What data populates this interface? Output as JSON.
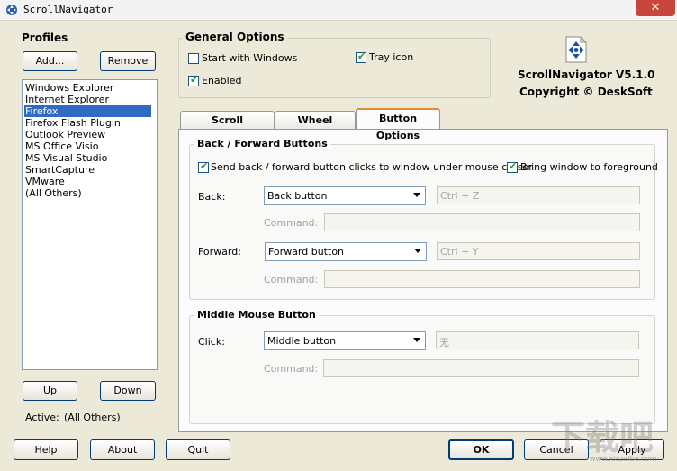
{
  "window": {
    "title": "ScrollNavigator",
    "close_label": "✕"
  },
  "profiles": {
    "heading": "Profiles",
    "add_label": "Add...",
    "remove_label": "Remove",
    "items": [
      "Windows Explorer",
      "Internet Explorer",
      "Firefox",
      "Firefox Flash Plugin",
      "Outlook Preview",
      "MS Office Visio",
      "MS Visual Studio",
      "SmartCapture",
      "VMware",
      "(All Others)"
    ],
    "selected": "Firefox",
    "up_label": "Up",
    "down_label": "Down",
    "active_label": "Active:",
    "active_value": "(All Others)"
  },
  "general": {
    "heading": "General Options",
    "start_with_windows": {
      "label": "Start with Windows",
      "checked": false
    },
    "tray_icon": {
      "label": "Tray icon",
      "checked": true
    },
    "enabled": {
      "label": "Enabled",
      "checked": true
    }
  },
  "about_box": {
    "product": "ScrollNavigator V5.1.0",
    "copyright": "Copyright © DeskSoft"
  },
  "tabs": [
    "Scroll Navigation",
    "Wheel Options",
    "Button Options"
  ],
  "active_tab": "Button Options",
  "back_forward": {
    "heading": "Back / Forward Buttons",
    "send_clicks": {
      "label": "Send back / forward button clicks to window under mouse cursor",
      "checked": true
    },
    "bring_foreground": {
      "label": "Bring window to foreground",
      "checked": true
    },
    "back_label": "Back:",
    "back_value": "Back button",
    "back_shortcut": "Ctrl + Z",
    "command_label": "Command:",
    "forward_label": "Forward:",
    "forward_value": "Forward button",
    "forward_shortcut": "Ctrl + Y"
  },
  "middle": {
    "heading": "Middle Mouse Button",
    "click_label": "Click:",
    "click_value": "Middle button",
    "click_shortcut": "无",
    "command_label": "Command:"
  },
  "footer": {
    "help_label": "Help",
    "about_label": "About",
    "quit_label": "Quit",
    "ok_label": "OK",
    "cancel_label": "Cancel",
    "apply_label": "Apply"
  },
  "watermark": {
    "text": "下载吧",
    "subtext": "www.xiazaiba.com"
  },
  "colors": {
    "selection": "#316ac5",
    "window_bg": "#ece9d8",
    "tab_accent": "#e68b2c",
    "check": "#21a121"
  }
}
